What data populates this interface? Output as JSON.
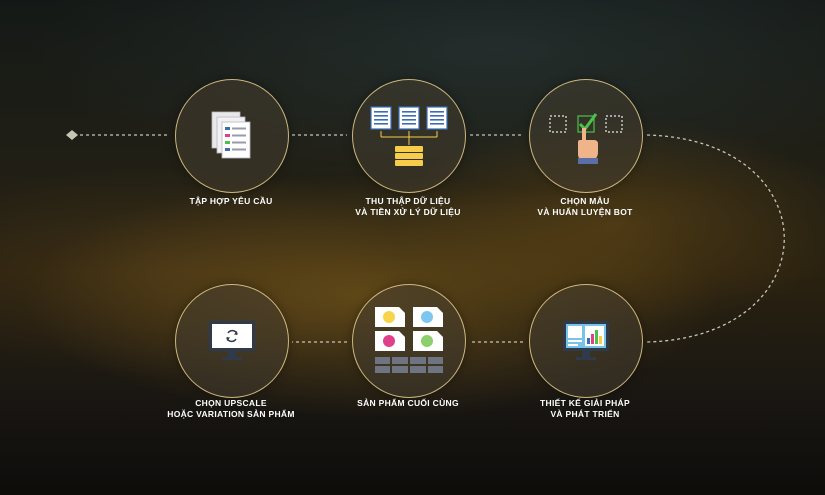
{
  "steps": [
    {
      "id": "requirements",
      "line1": "TẬP HỢP YÊU CẦU",
      "line2": "",
      "icon": "documents-icon"
    },
    {
      "id": "data-collection",
      "line1": "THU THẬP DỮ LIỆU",
      "line2": "VÀ TIỀN XỬ LÝ DỮ LIỆU",
      "icon": "database-icon"
    },
    {
      "id": "training",
      "line1": "CHỌN MẪU",
      "line2": "VÀ HUẤN LUYỆN BOT",
      "icon": "selection-hand-icon"
    },
    {
      "id": "design",
      "line1": "THIẾT KẾ GIẢI PHÁP",
      "line2": "VÀ PHÁT TRIỂN",
      "icon": "dashboard-monitor-icon"
    },
    {
      "id": "final-product",
      "line1": "SẢN PHẨM CUỐI CÙNG",
      "line2": "",
      "icon": "product-grid-icon"
    },
    {
      "id": "upscale",
      "line1": "CHỌN UPSCALE",
      "line2": "HOẶC VARIATION SẢN PHẨM",
      "icon": "refresh-monitor-icon"
    }
  ],
  "colors": {
    "ring": "#e6cd8c",
    "connector": "#c9c4b8",
    "doc_blue": "#3a6db5",
    "db_yellow": "#f5cd4a",
    "check_green": "#4cc04a",
    "hand_skin": "#f0b48a",
    "monitor_screen": "#78c3e8",
    "circle_yellow": "#f7d44a",
    "circle_blue": "#7cc7f0",
    "circle_pink": "#e0408a",
    "circle_green": "#8ccf6c"
  }
}
